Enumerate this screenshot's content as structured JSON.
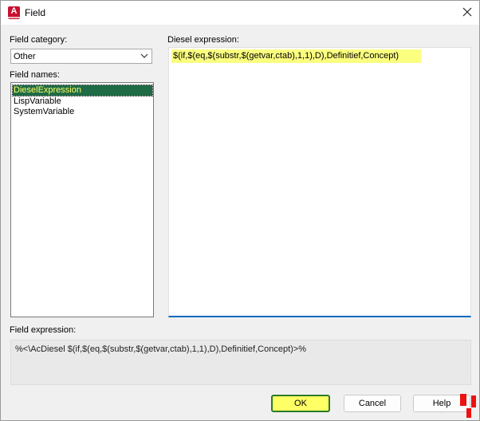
{
  "window": {
    "title": "Field",
    "app_icon_letter": "A",
    "close_icon": "close-icon"
  },
  "category": {
    "label": "Field category:",
    "selected": "Other"
  },
  "field_names": {
    "label": "Field names:",
    "items": [
      "DieselExpression",
      "LispVariable",
      "SystemVariable"
    ],
    "selected_index": 0
  },
  "diesel": {
    "label": "Diesel expression:",
    "value": "$(if,$(eq,$(substr,$(getvar,ctab),1,1),D),Definitief,Concept)"
  },
  "field_expression": {
    "label": "Field expression:",
    "value": "%<\\AcDiesel $(if,$(eq,$(substr,$(getvar,ctab),1,1),D),Definitief,Concept)>%"
  },
  "buttons": {
    "ok": "OK",
    "cancel": "Cancel",
    "help": "Help"
  },
  "colors": {
    "highlight": "#ffff66",
    "selection_bg": "#1e6b46",
    "accent": "#0067c0"
  }
}
